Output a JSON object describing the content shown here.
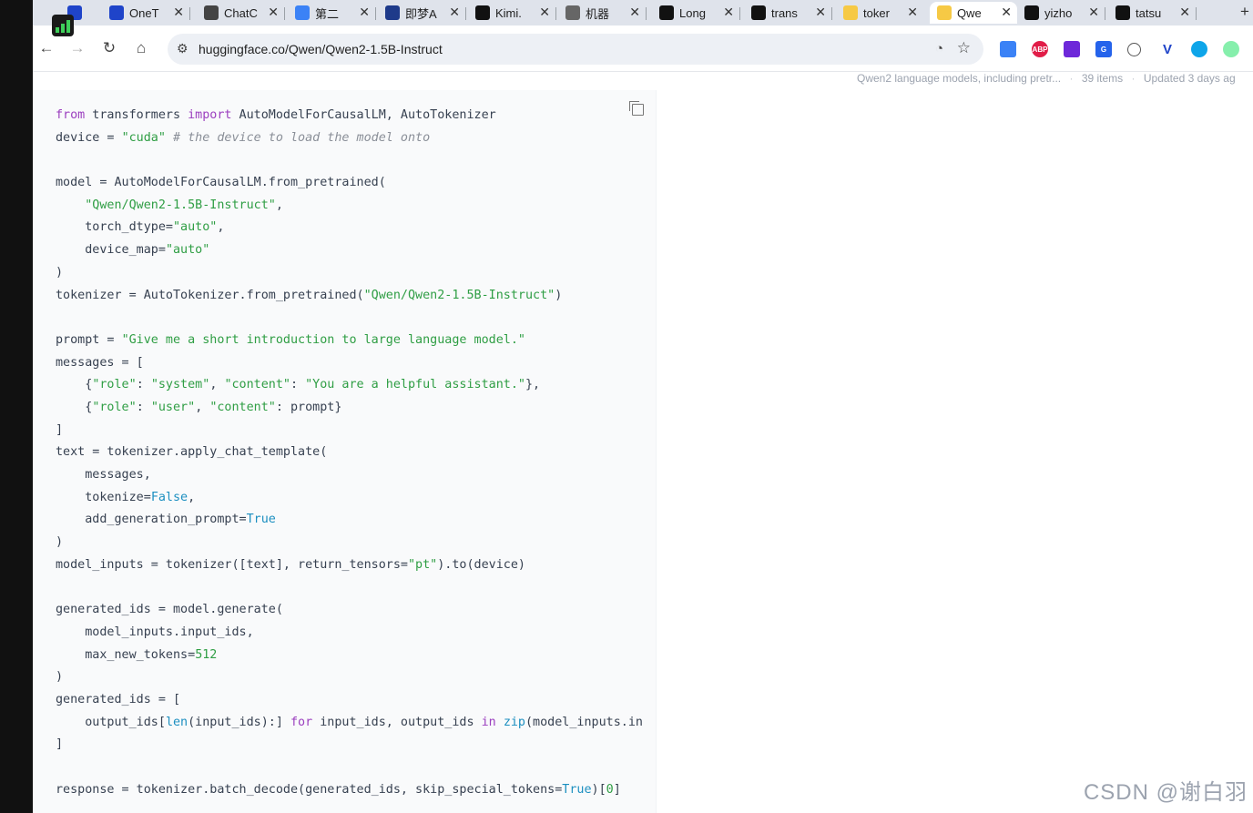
{
  "browser": {
    "tabs": [
      {
        "label": "",
        "icon": "v-logo-icon",
        "color": "#1f44c9"
      },
      {
        "label": "OneT",
        "icon": "v-logo-icon",
        "color": "#1f44c9"
      },
      {
        "label": "ChatC",
        "icon": "openai-icon",
        "color": "#444444"
      },
      {
        "label": "第二",
        "icon": "docs-icon",
        "color": "#3b82f6"
      },
      {
        "label": "即梦A",
        "icon": "dreamina-icon",
        "color": "#1e3a8a"
      },
      {
        "label": "Kimi.",
        "icon": "kimi-icon",
        "color": "#111111"
      },
      {
        "label": "机器",
        "icon": "wikipedia-icon",
        "color": "#666666"
      },
      {
        "label": "Long",
        "icon": "github-icon",
        "color": "#111111"
      },
      {
        "label": "trans",
        "icon": "github-icon",
        "color": "#111111"
      },
      {
        "label": "toker",
        "icon": "huggingface-icon",
        "color": "#f6c945"
      },
      {
        "label": "Qwe",
        "icon": "huggingface-icon",
        "color": "#f6c945",
        "active": true
      },
      {
        "label": "yizho",
        "icon": "github-icon",
        "color": "#111111"
      },
      {
        "label": "tatsu",
        "icon": "github-icon",
        "color": "#111111"
      }
    ],
    "new_tab": "+",
    "url": "huggingface.co/Qwen/Qwen2-1.5B-Instruct"
  },
  "collection": {
    "description": "Qwen2 language models, including pretr...",
    "items": "39 items",
    "updated": "Updated 3 days ag"
  },
  "code_lines": [
    [
      [
        "kw",
        "from"
      ],
      [
        "p",
        " transformers "
      ],
      [
        "kw",
        "import"
      ],
      [
        "p",
        " AutoModelForCausalLM, AutoTokenizer"
      ]
    ],
    [
      [
        "p",
        "device = "
      ],
      [
        "str",
        "\"cuda\""
      ],
      [
        "cm",
        " # the device to load the model onto"
      ]
    ],
    [],
    [
      [
        "p",
        "model = AutoModelForCausalLM.from_pretrained("
      ]
    ],
    [
      [
        "p",
        "    "
      ],
      [
        "str",
        "\"Qwen/Qwen2-1.5B-Instruct\""
      ],
      [
        "p",
        ","
      ]
    ],
    [
      [
        "p",
        "    torch_dtype="
      ],
      [
        "str",
        "\"auto\""
      ],
      [
        "p",
        ","
      ]
    ],
    [
      [
        "p",
        "    device_map="
      ],
      [
        "str",
        "\"auto\""
      ]
    ],
    [
      [
        "p",
        ")"
      ]
    ],
    [
      [
        "p",
        "tokenizer = AutoTokenizer.from_pretrained("
      ],
      [
        "str",
        "\"Qwen/Qwen2-1.5B-Instruct\""
      ],
      [
        "p",
        ")"
      ]
    ],
    [],
    [
      [
        "p",
        "prompt = "
      ],
      [
        "str",
        "\"Give me a short introduction to large language model.\""
      ]
    ],
    [
      [
        "p",
        "messages = ["
      ]
    ],
    [
      [
        "p",
        "    {"
      ],
      [
        "str",
        "\"role\""
      ],
      [
        "p",
        ": "
      ],
      [
        "str",
        "\"system\""
      ],
      [
        "p",
        ", "
      ],
      [
        "str",
        "\"content\""
      ],
      [
        "p",
        ": "
      ],
      [
        "str",
        "\"You are a helpful assistant.\""
      ],
      [
        "p",
        "},"
      ]
    ],
    [
      [
        "p",
        "    {"
      ],
      [
        "str",
        "\"role\""
      ],
      [
        "p",
        ": "
      ],
      [
        "str",
        "\"user\""
      ],
      [
        "p",
        ", "
      ],
      [
        "str",
        "\"content\""
      ],
      [
        "p",
        ": prompt}"
      ]
    ],
    [
      [
        "p",
        "]"
      ]
    ],
    [
      [
        "p",
        "text = tokenizer.apply_chat_template("
      ]
    ],
    [
      [
        "p",
        "    messages,"
      ]
    ],
    [
      [
        "p",
        "    tokenize="
      ],
      [
        "bi",
        "False"
      ],
      [
        "p",
        ","
      ]
    ],
    [
      [
        "p",
        "    add_generation_prompt="
      ],
      [
        "bi",
        "True"
      ]
    ],
    [
      [
        "p",
        ")"
      ]
    ],
    [
      [
        "p",
        "model_inputs = tokenizer([text], return_tensors="
      ],
      [
        "str",
        "\"pt\""
      ],
      [
        "p",
        ").to(device)"
      ]
    ],
    [],
    [
      [
        "p",
        "generated_ids = model.generate("
      ]
    ],
    [
      [
        "p",
        "    model_inputs.input_ids,"
      ]
    ],
    [
      [
        "p",
        "    max_new_tokens="
      ],
      [
        "str",
        "512"
      ]
    ],
    [
      [
        "p",
        ")"
      ]
    ],
    [
      [
        "p",
        "generated_ids = ["
      ]
    ],
    [
      [
        "p",
        "    output_ids["
      ],
      [
        "bi",
        "len"
      ],
      [
        "p",
        "(input_ids):] "
      ],
      [
        "kw",
        "for"
      ],
      [
        "p",
        " input_ids, output_ids "
      ],
      [
        "kw",
        "in"
      ],
      [
        "p",
        " "
      ],
      [
        "bi",
        "zip"
      ],
      [
        "p",
        "(model_inputs.in"
      ]
    ],
    [
      [
        "p",
        "]"
      ]
    ],
    [],
    [
      [
        "p",
        "response = tokenizer.batch_decode(generated_ids, skip_special_tokens="
      ],
      [
        "bi",
        "True"
      ],
      [
        "p",
        ")["
      ],
      [
        "str",
        "0"
      ],
      [
        "p",
        "]"
      ]
    ]
  ],
  "watermark": "CSDN @谢白羽"
}
